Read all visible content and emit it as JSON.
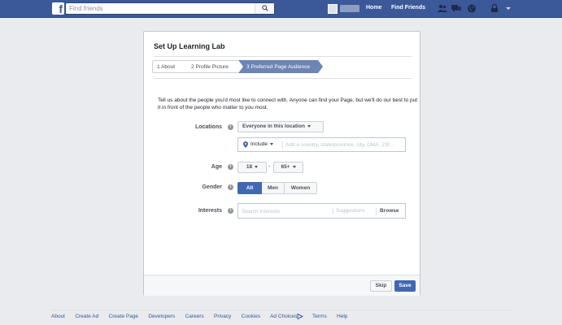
{
  "search": {
    "placeholder": "Find friends"
  },
  "nav": {
    "home": "Home",
    "find_friends": "Find Friends"
  },
  "dialog": {
    "title": "Set Up Learning Lab",
    "steps": [
      {
        "num": "1",
        "label": "About"
      },
      {
        "num": "2",
        "label": "Profile Picture"
      },
      {
        "num": "3",
        "label": "Preferred Page Audience"
      }
    ],
    "intro": "Tell us about the people you'd most like to connect with. Anyone can find your Page, but we'll do our best to put it in front of the people who matter to you most.",
    "locations": {
      "label": "Locations",
      "dropdown": "Everyone in this location",
      "include": "Include",
      "placeholder": "Add a country, state/province, city, DMA, ZIP..."
    },
    "age": {
      "label": "Age",
      "min": "18",
      "dash": "-",
      "max": "65+"
    },
    "gender": {
      "label": "Gender",
      "options": [
        "All",
        "Men",
        "Women"
      ],
      "selected": "All"
    },
    "interests": {
      "label": "Interests",
      "placeholder": "Search interests",
      "suggestions": "Suggestions",
      "browse": "Browse"
    },
    "buttons": {
      "skip": "Skip",
      "save": "Save"
    }
  },
  "footer": {
    "links": [
      "About",
      "Create Ad",
      "Create Page",
      "Developers",
      "Careers",
      "Privacy",
      "Cookies",
      "Ad Choices",
      "Terms",
      "Help"
    ]
  },
  "colors": {
    "brand": "#3b5998",
    "primary_button": "#4267b2",
    "active_step": "#6d84b4"
  }
}
